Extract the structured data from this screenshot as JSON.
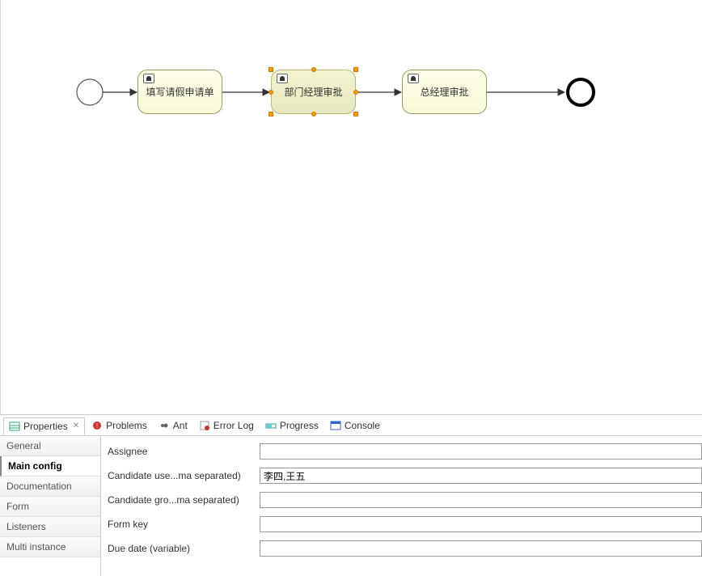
{
  "diagram": {
    "tasks": {
      "task1": {
        "label": "填写请假申请单"
      },
      "task2": {
        "label": "部门经理审批"
      },
      "task3": {
        "label": "总经理审批"
      }
    }
  },
  "bottom_tabs": {
    "properties": "Properties",
    "problems": "Problems",
    "ant": "Ant",
    "error_log": "Error Log",
    "progress": "Progress",
    "console": "Console"
  },
  "side_tabs": {
    "general": "General",
    "main_config": "Main config",
    "documentation": "Documentation",
    "form": "Form",
    "listeners": "Listeners",
    "multi_instance": "Multi instance"
  },
  "properties_form": {
    "assignee": {
      "label": "Assignee",
      "value": ""
    },
    "candidate_users": {
      "label": "Candidate use...ma separated)",
      "value": "李四,王五"
    },
    "candidate_groups": {
      "label": "Candidate gro...ma separated)",
      "value": ""
    },
    "form_key": {
      "label": "Form key",
      "value": ""
    },
    "due_date": {
      "label": "Due date (variable)",
      "value": ""
    }
  }
}
